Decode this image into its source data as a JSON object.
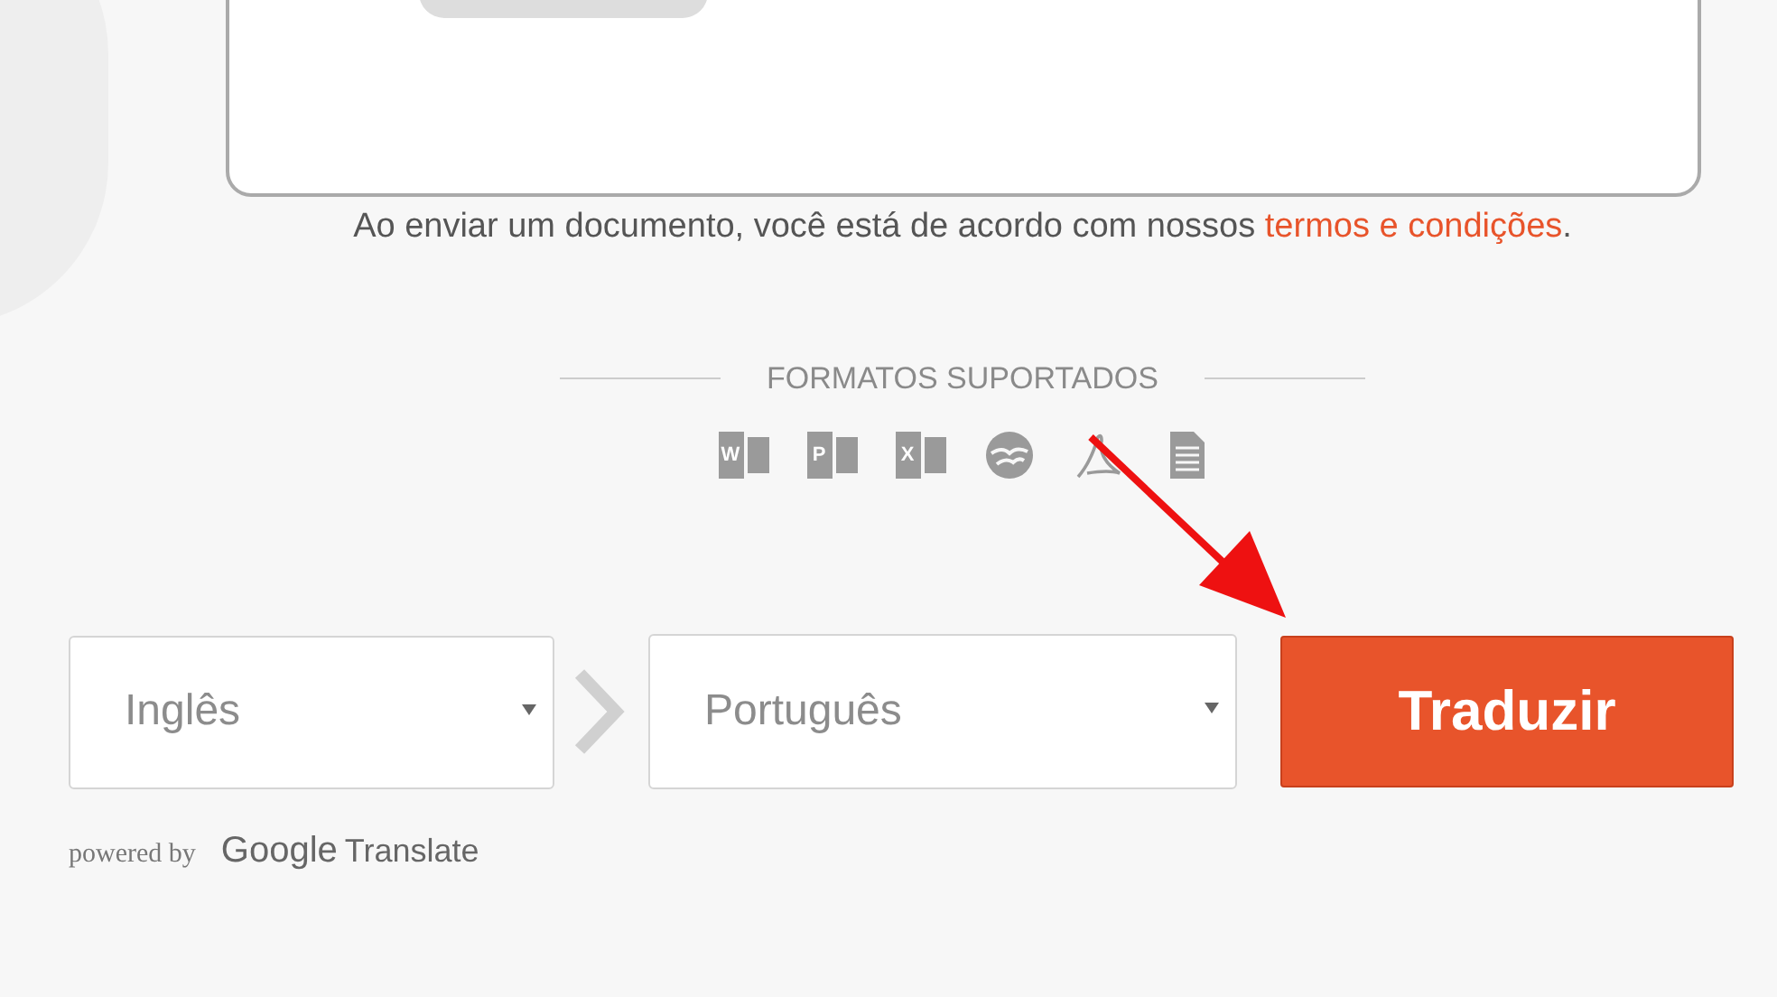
{
  "upload_area": {
    "notice": "Ao enviar um documento, você está de acordo com nossos ",
    "terms_link": "termos e condições",
    "notice_end": "."
  },
  "formats": {
    "heading": "FORMATOS SUPORTADOS",
    "icons": [
      {
        "kind": "word",
        "letter": "W"
      },
      {
        "kind": "powerpoint",
        "letter": "P"
      },
      {
        "kind": "excel",
        "letter": "X"
      },
      {
        "kind": "openoffice"
      },
      {
        "kind": "pdf"
      },
      {
        "kind": "text"
      }
    ]
  },
  "source_language": {
    "value": "Inglês"
  },
  "target_language": {
    "value": "Português"
  },
  "translate_button": "Traduzir",
  "powered_by": {
    "label": "powered by",
    "brand": "Google",
    "product": "Translate"
  }
}
